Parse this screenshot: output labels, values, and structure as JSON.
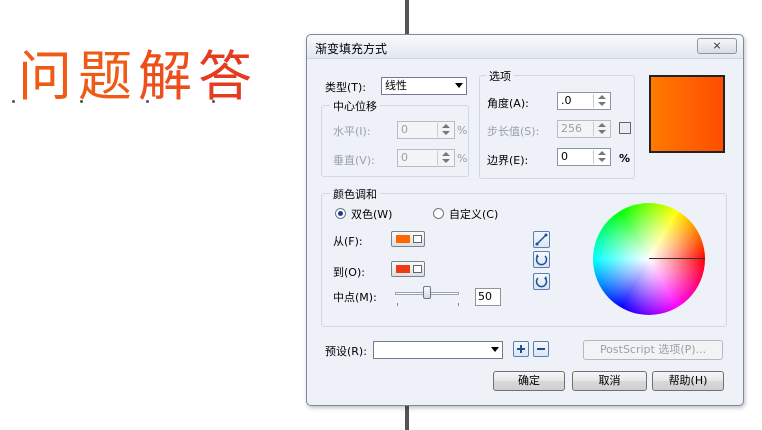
{
  "slide_title": {
    "chars": [
      "问",
      "题",
      "解",
      "答"
    ]
  },
  "dialog": {
    "title": "渐变填充方式",
    "close_symbol": "⨯",
    "type_label": "类型(T):",
    "type_value": "线性",
    "center_offset": {
      "legend": "中心位移",
      "horizontal_label": "水平(I):",
      "horizontal_value": "0",
      "vertical_label": "垂直(V):",
      "vertical_value": "0",
      "unit": "%"
    },
    "options": {
      "legend": "选项",
      "angle_label": "角度(A):",
      "angle_value": ".0",
      "steps_label": "步长值(S):",
      "steps_value": "256",
      "edge_label": "边界(E):",
      "edge_value": "0",
      "unit": "%"
    },
    "color_blend": {
      "legend": "颜色调和",
      "two_color_label": "双色(W)",
      "custom_label": "自定义(C)",
      "selected": "two_color",
      "from_label": "从(F):",
      "from_color": "#ff6600",
      "to_label": "到(O):",
      "to_color": "#ef3a16",
      "midpoint_label": "中点(M):",
      "midpoint_value": "50",
      "midpoint_fraction": 0.5
    },
    "presets_label": "预设(R):",
    "presets_value": "",
    "postscript_button": "PostScript 选项(P)...",
    "ok_button": "确定",
    "cancel_button": "取消",
    "help_button": "帮助(H)"
  }
}
